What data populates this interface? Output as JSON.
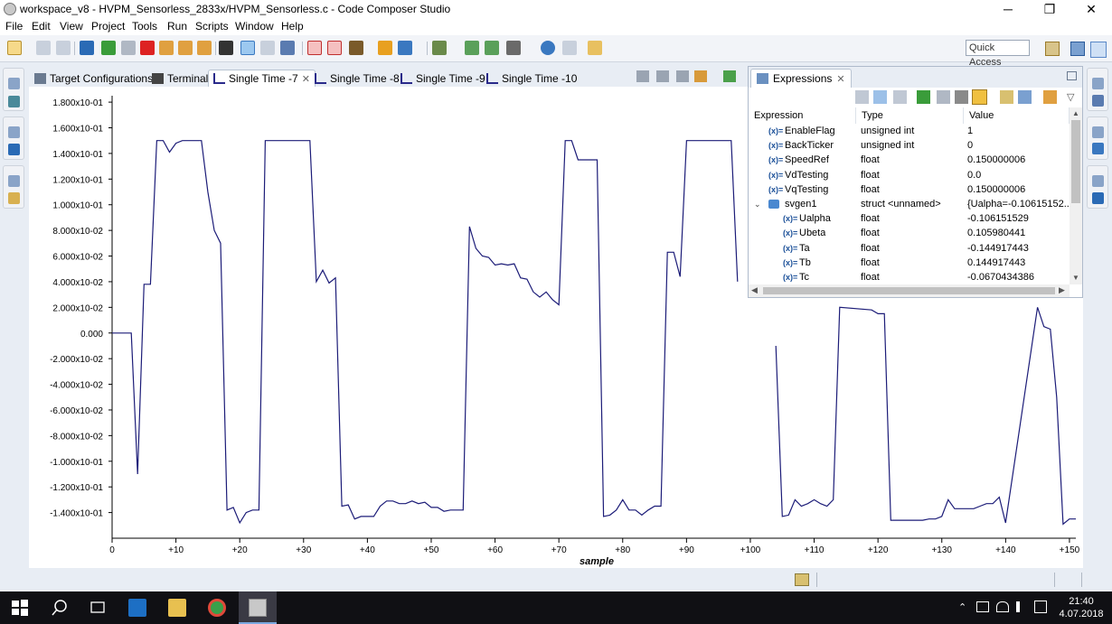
{
  "window": {
    "title": "workspace_v8 - HVPM_Sensorless_2833x/HVPM_Sensorless.c - Code Composer Studio",
    "minimize": "─",
    "restore": "❐",
    "close": "✕"
  },
  "menu": [
    "File",
    "Edit",
    "View",
    "Project",
    "Tools",
    "Run",
    "Scripts",
    "Window",
    "Help"
  ],
  "quick_access": "Quick Access",
  "tabs": [
    {
      "label": "Target Configurations",
      "icon": "target-config-icon"
    },
    {
      "label": "Terminal",
      "icon": "terminal-icon"
    },
    {
      "label": "Single Time -7",
      "icon": "graph-icon",
      "active": true,
      "close": "✕"
    },
    {
      "label": "Single Time -8",
      "icon": "graph-icon"
    },
    {
      "label": "Single Time -9",
      "icon": "graph-icon"
    },
    {
      "label": "Single Time -10",
      "icon": "graph-icon"
    }
  ],
  "expressions": {
    "tab_label": "Expressions",
    "tab_close": "✕",
    "columns": [
      "Expression",
      "Type",
      "Value"
    ],
    "rows": [
      {
        "name": "EnableFlag",
        "type": "unsigned int",
        "value": "1",
        "indent": 0
      },
      {
        "name": "BackTicker",
        "type": "unsigned int",
        "value": "0",
        "indent": 0
      },
      {
        "name": "SpeedRef",
        "type": "float",
        "value": "0.150000006",
        "indent": 0
      },
      {
        "name": "VdTesting",
        "type": "float",
        "value": "0.0",
        "indent": 0
      },
      {
        "name": "VqTesting",
        "type": "float",
        "value": "0.150000006",
        "indent": 0
      },
      {
        "name": "svgen1",
        "type": "struct <unnamed>",
        "value": "{Ualpha=-0.10615152...",
        "indent": 0,
        "struct": true
      },
      {
        "name": "Ualpha",
        "type": "float",
        "value": "-0.106151529",
        "indent": 1
      },
      {
        "name": "Ubeta",
        "type": "float",
        "value": "0.105980441",
        "indent": 1
      },
      {
        "name": "Ta",
        "type": "float",
        "value": "-0.144917443",
        "indent": 1
      },
      {
        "name": "Tb",
        "type": "float",
        "value": "0.144917443",
        "indent": 1
      },
      {
        "name": "Tc",
        "type": "float",
        "value": "-0.0670434386",
        "indent": 1
      }
    ]
  },
  "chart_data": {
    "type": "line",
    "xlabel": "sample",
    "ylabel": "",
    "title": "",
    "xlim": [
      0,
      151
    ],
    "ylim": [
      -0.16,
      0.185
    ],
    "y_ticks": [
      {
        "v": 0.18,
        "label": "1.800x10-01"
      },
      {
        "v": 0.16,
        "label": "1.600x10-01"
      },
      {
        "v": 0.14,
        "label": "1.400x10-01"
      },
      {
        "v": 0.12,
        "label": "1.200x10-01"
      },
      {
        "v": 0.1,
        "label": "1.000x10-01"
      },
      {
        "v": 0.08,
        "label": "8.000x10-02"
      },
      {
        "v": 0.06,
        "label": "6.000x10-02"
      },
      {
        "v": 0.04,
        "label": "4.000x10-02"
      },
      {
        "v": 0.02,
        "label": "2.000x10-02"
      },
      {
        "v": 0.0,
        "label": "0.000"
      },
      {
        "v": -0.02,
        "label": "-2.000x10-02"
      },
      {
        "v": -0.04,
        "label": "-4.000x10-02"
      },
      {
        "v": -0.06,
        "label": "-6.000x10-02"
      },
      {
        "v": -0.08,
        "label": "-8.000x10-02"
      },
      {
        "v": -0.1,
        "label": "-1.000x10-01"
      },
      {
        "v": -0.12,
        "label": "-1.200x10-01"
      },
      {
        "v": -0.14,
        "label": "-1.400x10-01"
      }
    ],
    "x_ticks": [
      {
        "v": 0,
        "label": "0"
      },
      {
        "v": 10,
        "label": "+10"
      },
      {
        "v": 20,
        "label": "+20"
      },
      {
        "v": 30,
        "label": "+30"
      },
      {
        "v": 40,
        "label": "+40"
      },
      {
        "v": 50,
        "label": "+50"
      },
      {
        "v": 60,
        "label": "+60"
      },
      {
        "v": 70,
        "label": "+70"
      },
      {
        "v": 80,
        "label": "+80"
      },
      {
        "v": 90,
        "label": "+90"
      },
      {
        "v": 100,
        "label": "+100"
      },
      {
        "v": 110,
        "label": "+110"
      },
      {
        "v": 120,
        "label": "+120"
      },
      {
        "v": 130,
        "label": "+130"
      },
      {
        "v": 140,
        "label": "+140"
      },
      {
        "v": 150,
        "label": "+150"
      }
    ],
    "series": [
      {
        "color": "#1c1c78",
        "x": [
          0,
          3,
          4,
          5,
          6,
          7,
          8,
          9,
          10,
          11,
          12,
          13,
          14,
          15,
          16,
          17,
          18,
          19,
          20,
          21,
          22,
          23,
          24,
          25,
          26,
          27,
          28,
          29,
          30,
          31,
          32,
          33,
          34,
          35,
          36,
          37,
          38,
          39,
          40,
          41,
          42,
          43,
          44,
          45,
          46,
          47,
          48,
          49,
          50,
          51,
          52,
          53,
          54,
          55,
          56,
          57,
          58,
          59,
          60,
          61,
          62,
          63,
          64,
          65,
          66,
          67,
          68,
          69,
          70,
          71,
          72,
          73,
          74,
          75,
          76,
          77,
          78,
          79,
          80,
          81,
          82,
          83,
          84,
          85,
          86,
          87,
          88,
          89,
          90,
          91,
          92,
          93,
          94,
          95,
          96,
          97,
          98
        ],
        "y": [
          0,
          0,
          -0.11,
          0.038,
          0.038,
          0.15,
          0.15,
          0.141,
          0.148,
          0.15,
          0.15,
          0.15,
          0.15,
          0.11,
          0.08,
          0.07,
          -0.138,
          -0.136,
          -0.148,
          -0.14,
          -0.138,
          -0.138,
          0.15,
          0.15,
          0.15,
          0.15,
          0.15,
          0.15,
          0.15,
          0.15,
          0.04,
          0.049,
          0.039,
          0.043,
          -0.135,
          -0.134,
          -0.145,
          -0.143,
          -0.143,
          -0.143,
          -0.135,
          -0.131,
          -0.131,
          -0.133,
          -0.133,
          -0.131,
          -0.133,
          -0.132,
          -0.136,
          -0.136,
          -0.139,
          -0.138,
          -0.138,
          -0.138,
          0.083,
          0.066,
          0.06,
          0.059,
          0.053,
          0.054,
          0.053,
          0.054,
          0.043,
          0.042,
          0.032,
          0.028,
          0.032,
          0.026,
          0.022,
          0.15,
          0.15,
          0.135,
          0.135,
          0.135,
          0.135,
          -0.143,
          -0.142,
          -0.138,
          -0.13,
          -0.138,
          -0.138,
          -0.142,
          -0.138,
          -0.135,
          -0.135,
          0.063,
          0.063,
          0.044,
          0.15,
          0.15,
          0.15,
          0.15,
          0.15,
          0.15,
          0.15,
          0.15,
          0.04
        ]
      },
      {
        "color": "#1c1c78",
        "x": [
          104,
          105,
          106,
          107,
          108,
          109,
          110,
          111,
          112,
          113,
          114,
          119,
          120,
          121,
          122,
          123,
          124,
          125,
          126,
          127,
          128,
          129,
          130,
          131,
          132,
          133,
          134,
          135,
          136,
          137,
          138,
          139,
          140,
          145,
          146,
          147,
          148,
          149,
          150,
          151
        ],
        "y": [
          -0.01,
          -0.143,
          -0.142,
          -0.13,
          -0.135,
          -0.133,
          -0.13,
          -0.133,
          -0.135,
          -0.13,
          0.02,
          0.018,
          0.015,
          0.015,
          -0.146,
          -0.146,
          -0.146,
          -0.146,
          -0.146,
          -0.146,
          -0.145,
          -0.145,
          -0.143,
          -0.13,
          -0.137,
          -0.137,
          -0.137,
          -0.137,
          -0.135,
          -0.133,
          -0.133,
          -0.128,
          -0.148,
          0.02,
          0.005,
          0.003,
          -0.05,
          -0.149,
          -0.145,
          -0.145
        ]
      }
    ]
  }
}
